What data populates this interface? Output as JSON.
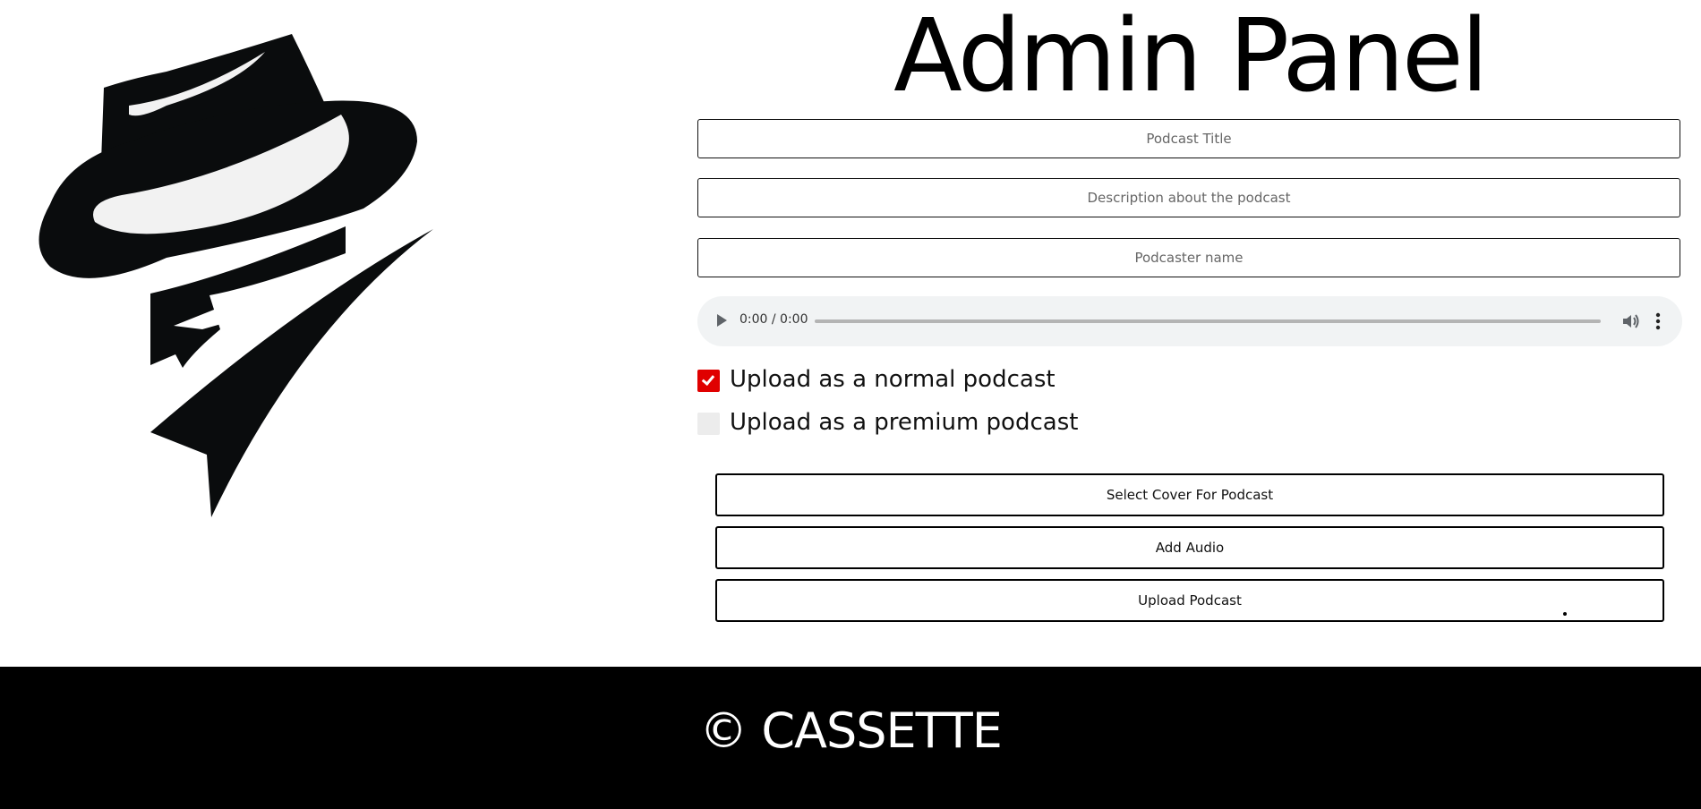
{
  "header": {
    "title": "Admin Panel"
  },
  "logo": {
    "icon": "fedora-man-icon"
  },
  "form": {
    "title_placeholder": "Podcast Title",
    "description_placeholder": "Description about the podcast",
    "podcaster_placeholder": "Podcaster name",
    "audio": {
      "time": "0:00 / 0:00"
    },
    "options": [
      {
        "label": "Upload as a normal podcast",
        "checked": true
      },
      {
        "label": "Upload as a premium podcast",
        "checked": false
      }
    ],
    "select_cover_label": "Select Cover For Podcast",
    "add_audio_label": "Add Audio",
    "upload_label": "Upload Podcast"
  },
  "footer": {
    "text": "© CASSETTE"
  },
  "colors": {
    "accent": "#e00000",
    "footer_bg": "#000000",
    "audio_bg": "#f1f3f4"
  }
}
